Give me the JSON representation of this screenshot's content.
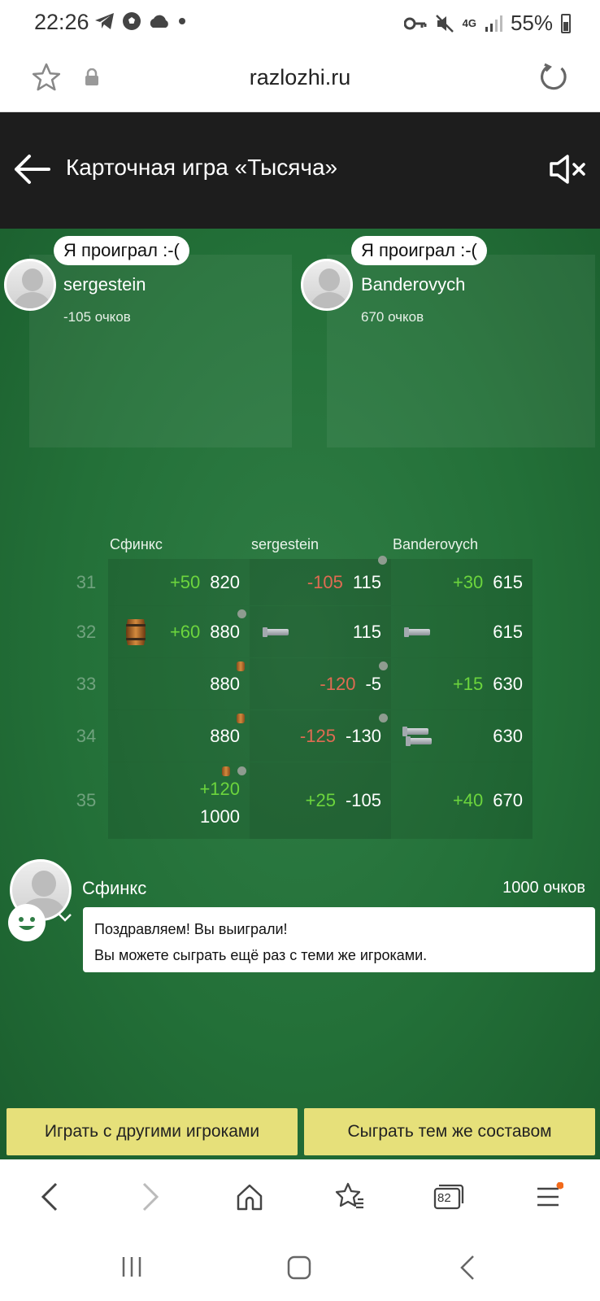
{
  "status_bar": {
    "time": "22:26",
    "battery": "55%",
    "network": "4G"
  },
  "browser": {
    "url": "razlozhi.ru",
    "tabs_count": "82"
  },
  "header": {
    "title": "Карточная игра «Тысяча»"
  },
  "opponents": [
    {
      "bubble": "Я проиграл :-(",
      "name": "sergestein",
      "score": "-105 очков"
    },
    {
      "bubble": "Я проиграл :-(",
      "name": "Banderovych",
      "score": "670 очков"
    }
  ],
  "score_table": {
    "columns": [
      "Сфинкс",
      "sergestein",
      "Banderovych"
    ],
    "rows": [
      {
        "num": "31",
        "cells": [
          {
            "delta": "+50",
            "total": "820"
          },
          {
            "delta": "-105",
            "total": "115"
          },
          {
            "delta": "+30",
            "total": "615"
          }
        ]
      },
      {
        "num": "32",
        "cells": [
          {
            "delta": "+60",
            "total": "880"
          },
          {
            "delta": "",
            "total": "115"
          },
          {
            "delta": "",
            "total": "615"
          }
        ]
      },
      {
        "num": "33",
        "cells": [
          {
            "delta": "",
            "total": "880"
          },
          {
            "delta": "-120",
            "total": "-5"
          },
          {
            "delta": "+15",
            "total": "630"
          }
        ]
      },
      {
        "num": "34",
        "cells": [
          {
            "delta": "",
            "total": "880"
          },
          {
            "delta": "-125",
            "total": "-130"
          },
          {
            "delta": "",
            "total": "630"
          }
        ]
      },
      {
        "num": "35",
        "cells": [
          {
            "delta": "+120",
            "total": "1000"
          },
          {
            "delta": "+25",
            "total": "-105"
          },
          {
            "delta": "+40",
            "total": "670"
          }
        ]
      }
    ]
  },
  "winner": {
    "name": "Сфинкс",
    "score": "1000 очков",
    "message_line1": "Поздравляем! Вы выиграли!",
    "message_line2": "Вы можете сыграть ещё раз с теми же игроками."
  },
  "actions": {
    "play_others": "Играть с другими игроками",
    "play_same": "Сыграть тем же составом"
  },
  "colors": {
    "table_green": "#237038",
    "positive": "#6cd53d",
    "negative": "#e06b52",
    "button": "#e6e07a"
  }
}
